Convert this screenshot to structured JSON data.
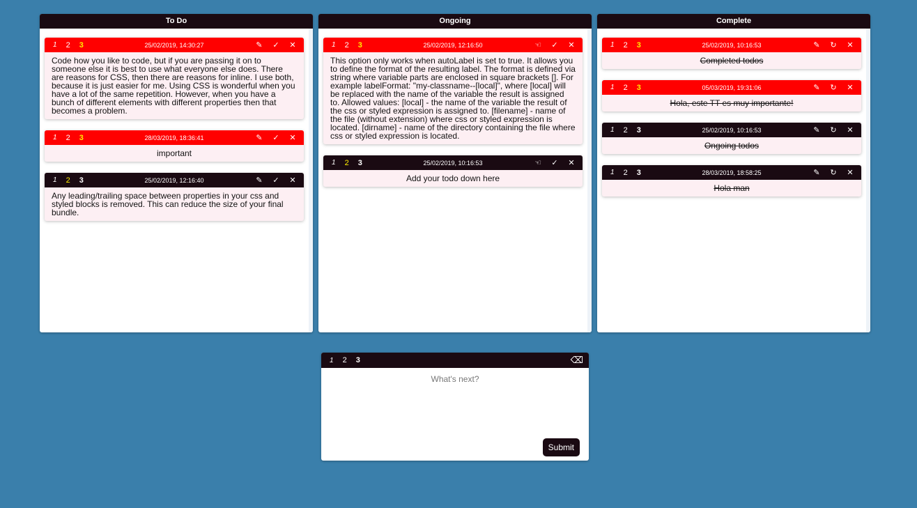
{
  "colors": {
    "background": "#3a7fab",
    "header": "#1a0a12",
    "urgent": "#ff0000",
    "card": "#fdeff3",
    "active_priority": "#ffee00"
  },
  "priority_labels": [
    "1",
    "2",
    "3"
  ],
  "icons": {
    "edit": "pencil-icon",
    "complete": "check-icon",
    "start": "pointing-hand-icon",
    "restore": "refresh-icon",
    "delete": "close-icon",
    "clear": "backspace-icon"
  },
  "columns": {
    "todo": {
      "title": "To Do",
      "cards": [
        {
          "timestamp": "25/02/2019, 14:30:27",
          "urgent": true,
          "priority": 3,
          "text": "Code how you like to code, but if you are passing it on to someone else it is best to use what everyone else does. There are reasons for CSS, then there are reasons for inline. I use both, because it is just easier for me. Using CSS is wonderful when you have a lot of the same repetition. However, when you have a bunch of different elements with different properties then that becomes a problem."
        },
        {
          "timestamp": "28/03/2019, 18:36:41",
          "urgent": true,
          "priority": 3,
          "text": "important"
        },
        {
          "timestamp": "25/02/2019, 12:16:40",
          "urgent": false,
          "priority": 2,
          "text": "Any leading/trailing space between properties in your css and styled blocks is removed. This can reduce the size of your final bundle."
        }
      ]
    },
    "ongoing": {
      "title": "Ongoing",
      "cards": [
        {
          "timestamp": "25/02/2019, 12:16:50",
          "urgent": true,
          "priority": 3,
          "text": "This option only works when autoLabel is set to true. It allows you to define the format of the resulting label. The format is defined via string where variable parts are enclosed in square brackets []. For example labelFormat: \"my-classname--[local]\", where [local] will be replaced with the name of the variable the result is assigned to. Allowed values: [local] - the name of the variable the result of the css or styled expression is assigned to. [filename] - name of the file (without extension) where css or styled expression is located. [dirname] - name of the directory containing the file where css or styled expression is located."
        },
        {
          "timestamp": "25/02/2019, 10:16:53",
          "urgent": false,
          "priority": 2,
          "text": "Add your todo down here"
        }
      ]
    },
    "complete": {
      "title": "Complete",
      "cards": [
        {
          "timestamp": "25/02/2019, 10:16:53",
          "urgent": true,
          "priority": 3,
          "text": "Completed todos"
        },
        {
          "timestamp": "05/03/2019, 19:31:06",
          "urgent": true,
          "priority": 3,
          "text": "Hola, este TT es muy importante!"
        },
        {
          "timestamp": "25/02/2019, 10:16:53",
          "urgent": false,
          "priority": 0,
          "text": "Ongoing todos"
        },
        {
          "timestamp": "28/03/2019, 18:58:25",
          "urgent": false,
          "priority": 0,
          "text": "Hola man"
        }
      ]
    }
  },
  "form": {
    "placeholder": "What's next?",
    "value": "",
    "submit_label": "Submit",
    "priority": 0
  }
}
